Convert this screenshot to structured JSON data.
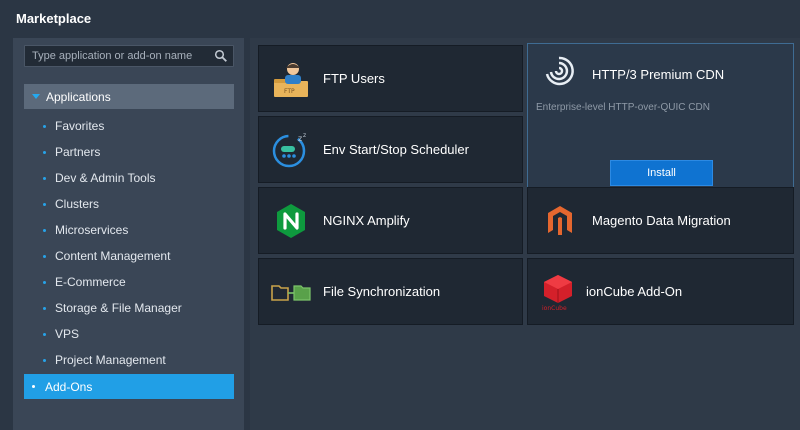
{
  "window": {
    "title": "Marketplace"
  },
  "search": {
    "placeholder": "Type application or add-on name"
  },
  "sidebar": {
    "group": "Applications",
    "items": [
      {
        "label": "Favorites"
      },
      {
        "label": "Partners"
      },
      {
        "label": "Dev & Admin Tools"
      },
      {
        "label": "Clusters"
      },
      {
        "label": "Microservices"
      },
      {
        "label": "Content Management"
      },
      {
        "label": "E-Commerce"
      },
      {
        "label": "Storage & File Manager"
      },
      {
        "label": "VPS"
      },
      {
        "label": "Project Management"
      }
    ],
    "addons": "Add-Ons"
  },
  "tiles": {
    "ftp_users": {
      "name": "FTP Users",
      "icon": "ftp-user-icon"
    },
    "scheduler": {
      "name": "Env Start/Stop Scheduler",
      "icon": "scheduler-clock-icon"
    },
    "nginx": {
      "name": "NGINX Amplify",
      "icon": "nginx-logo"
    },
    "file_sync": {
      "name": "File Synchronization",
      "icon": "folder-sync-icon"
    },
    "http3": {
      "name": "HTTP/3 Premium CDN",
      "description": "Enterprise-level HTTP-over-QUIC CDN",
      "install_label": "Install",
      "icon": "swirl-cdn-icon"
    },
    "magento": {
      "name": "Magento Data Migration",
      "icon": "magento-logo"
    },
    "ioncube": {
      "name": "ionCube Add-On",
      "icon": "ioncube-logo",
      "logo_text": "ionCube"
    }
  },
  "colors": {
    "accent": "#219fe6",
    "install_button": "#0f73d1",
    "tile_bg": "#1f2833",
    "featured_border": "#3f6c93"
  }
}
